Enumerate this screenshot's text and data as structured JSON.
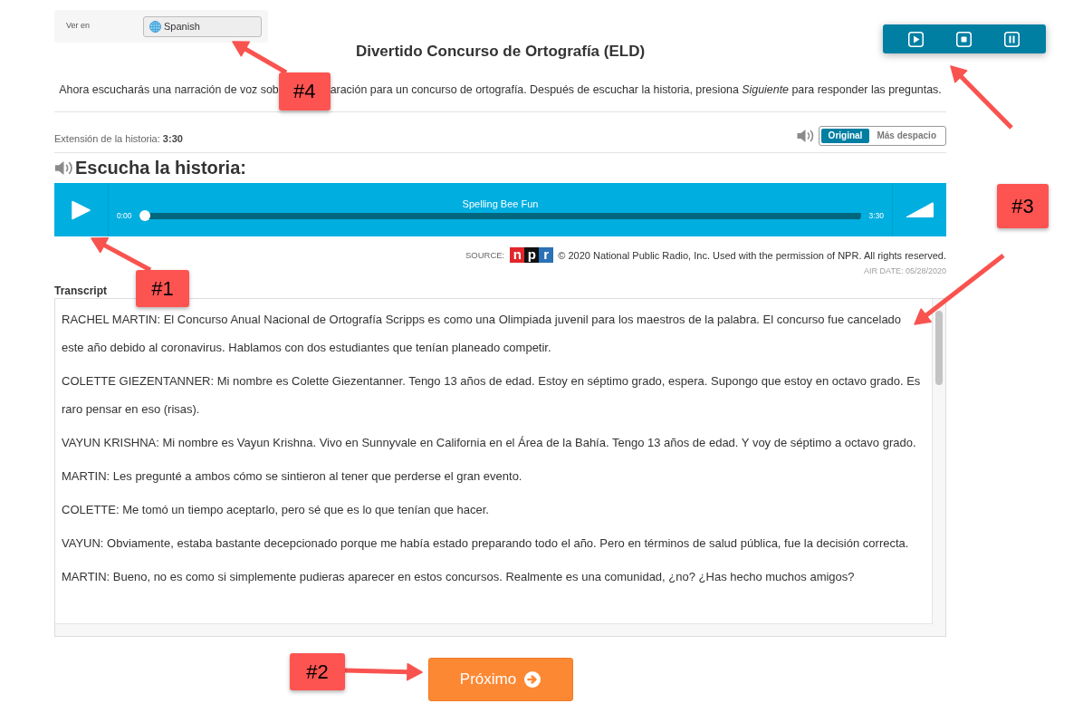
{
  "language_bar": {
    "label": "Ver en",
    "language": "Spanish"
  },
  "title": "Divertido Concurso de Ortografía (ELD)",
  "instructions": [
    "Ahora escucharás una narración de voz sob",
    "aración para un concurso de ortografía. Después de escuchar la historia, presiona *Siguiente* para responder las preguntas."
  ],
  "story_length": {
    "label": "Extensión de la historia:",
    "value": "3:30"
  },
  "speed_options": [
    {
      "label": "Original",
      "selected": true
    },
    {
      "label": "Más despacio",
      "selected": false
    }
  ],
  "section_heading": "Escucha la historia:",
  "player": {
    "track_title": "Spelling Bee Fun",
    "elapsed": "0:00",
    "duration": "3:30",
    "level": 0
  },
  "source": {
    "label": "SOURCE:",
    "logo": [
      "n",
      "p",
      "r"
    ],
    "credit": "© 2020 National Public Radio, Inc. Used with the permission of NPR. All rights reserved.",
    "air_date": "AIR DATE: 05/28/2020"
  },
  "transcript": {
    "heading": "Transcript",
    "paragraphs": [
      "RACHEL MARTIN: El Concurso Anual Nacional de Ortografía Scripps es como una Olimpiada juvenil para los maestros de la palabra. El concurso fue cancelado este año debido al coronavirus. Hablamos con dos estudiantes que tenían planeado competir.",
      "COLETTE GIEZENTANNER: Mi nombre es Colette Giezentanner. Tengo 13 años de edad. Estoy en séptimo grado, espera. Supongo que estoy en octavo grado. Es raro pensar en eso (risas).",
      "VAYUN KRISHNA: Mi nombre es Vayun Krishna. Vivo en Sunnyvale en California en el Área de la Bahía. Tengo 13 años de edad. Y voy de séptimo a octavo grado.",
      "MARTIN: Les pregunté a ambos cómo se sintieron al tener que perderse el gran evento.",
      "COLETTE: Me tomó un tiempo aceptarlo, pero sé que es lo que tenían que hacer.",
      "VAYUN: Obviamente, estaba bastante decepcionado porque me había estado preparando todo el año. Pero en términos de salud pública, fue la decisión correcta.",
      "MARTIN: Bueno, no es como si simplemente pudieras aparecer en estos concursos. Realmente es una comunidad, ¿no? ¿Has hecho muchos amigos?"
    ]
  },
  "next_button": "Próximo",
  "annotations": [
    {
      "kind": "callout",
      "label": "#4"
    },
    {
      "kind": "arrow"
    },
    {
      "kind": "callout",
      "label": "#3"
    },
    {
      "kind": "callout",
      "label": "#1"
    },
    {
      "kind": "callout",
      "label": "#2"
    }
  ]
}
